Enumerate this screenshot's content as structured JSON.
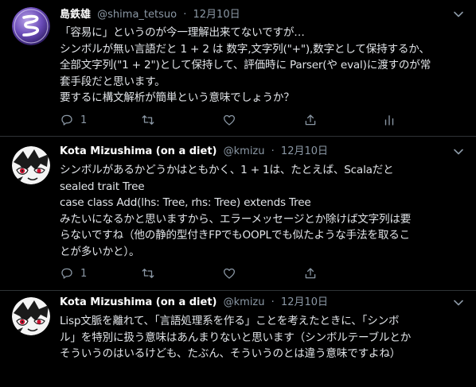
{
  "colors": {
    "background": "#000000",
    "text": "#e1e4e8",
    "secondary": "#8b98a5",
    "divider": "#2f3336"
  },
  "tweets": [
    {
      "author_name": "島鉄雄",
      "handle": "@shima_tetsuo",
      "separator": "·",
      "date": "12月10日",
      "lines": [
        "「容易に」というのが今一理解出来てないですが…",
        "シンボルが無い言語だと 1 + 2 は 数字,文字列(\"+\"),数字として保持するか、",
        "全部文字列(\"1 + 2\")として保持して、評価時に Parser(や eval)に渡すのが常",
        "套手段だと思います。",
        "要するに構文解析が簡単という意味でしょうか？"
      ],
      "reply_count": "1",
      "icons": [
        "reply-icon",
        "retweet-icon",
        "like-icon",
        "share-icon",
        "stats-icon"
      ]
    },
    {
      "author_name": "Kota Mizushima (on a diet)",
      "handle": "@kmizu",
      "separator": "·",
      "date": "12月10日",
      "lines": [
        "シンボルがあるかどうかはともかく、1 + 1は、たとえば、Scalaだと",
        "sealed trait Tree",
        "case class Add(lhs: Tree, rhs: Tree) extends Tree",
        "みたいになるかと思いますから、エラーメッセージとか除けば文字列は要",
        "らないですね（他の静的型付きFPでもOOPLでも似たような手法を取るこ",
        "とが多いかと）。"
      ],
      "reply_count": "1",
      "icons": [
        "reply-icon",
        "retweet-icon",
        "like-icon",
        "share-icon"
      ]
    },
    {
      "author_name": "Kota Mizushima (on a diet)",
      "handle": "@kmizu",
      "separator": "·",
      "date": "12月10日",
      "lines": [
        "Lisp文脈を離れて、「言語処理系を作る」ことを考えたときに、「シンボ",
        "ル」を特別に扱う意味はあんまりないと思います（シンボルテーブルとか",
        "そういうのはいるけども、たぶん、そういうのとは違う意味ですよね）"
      ]
    }
  ]
}
